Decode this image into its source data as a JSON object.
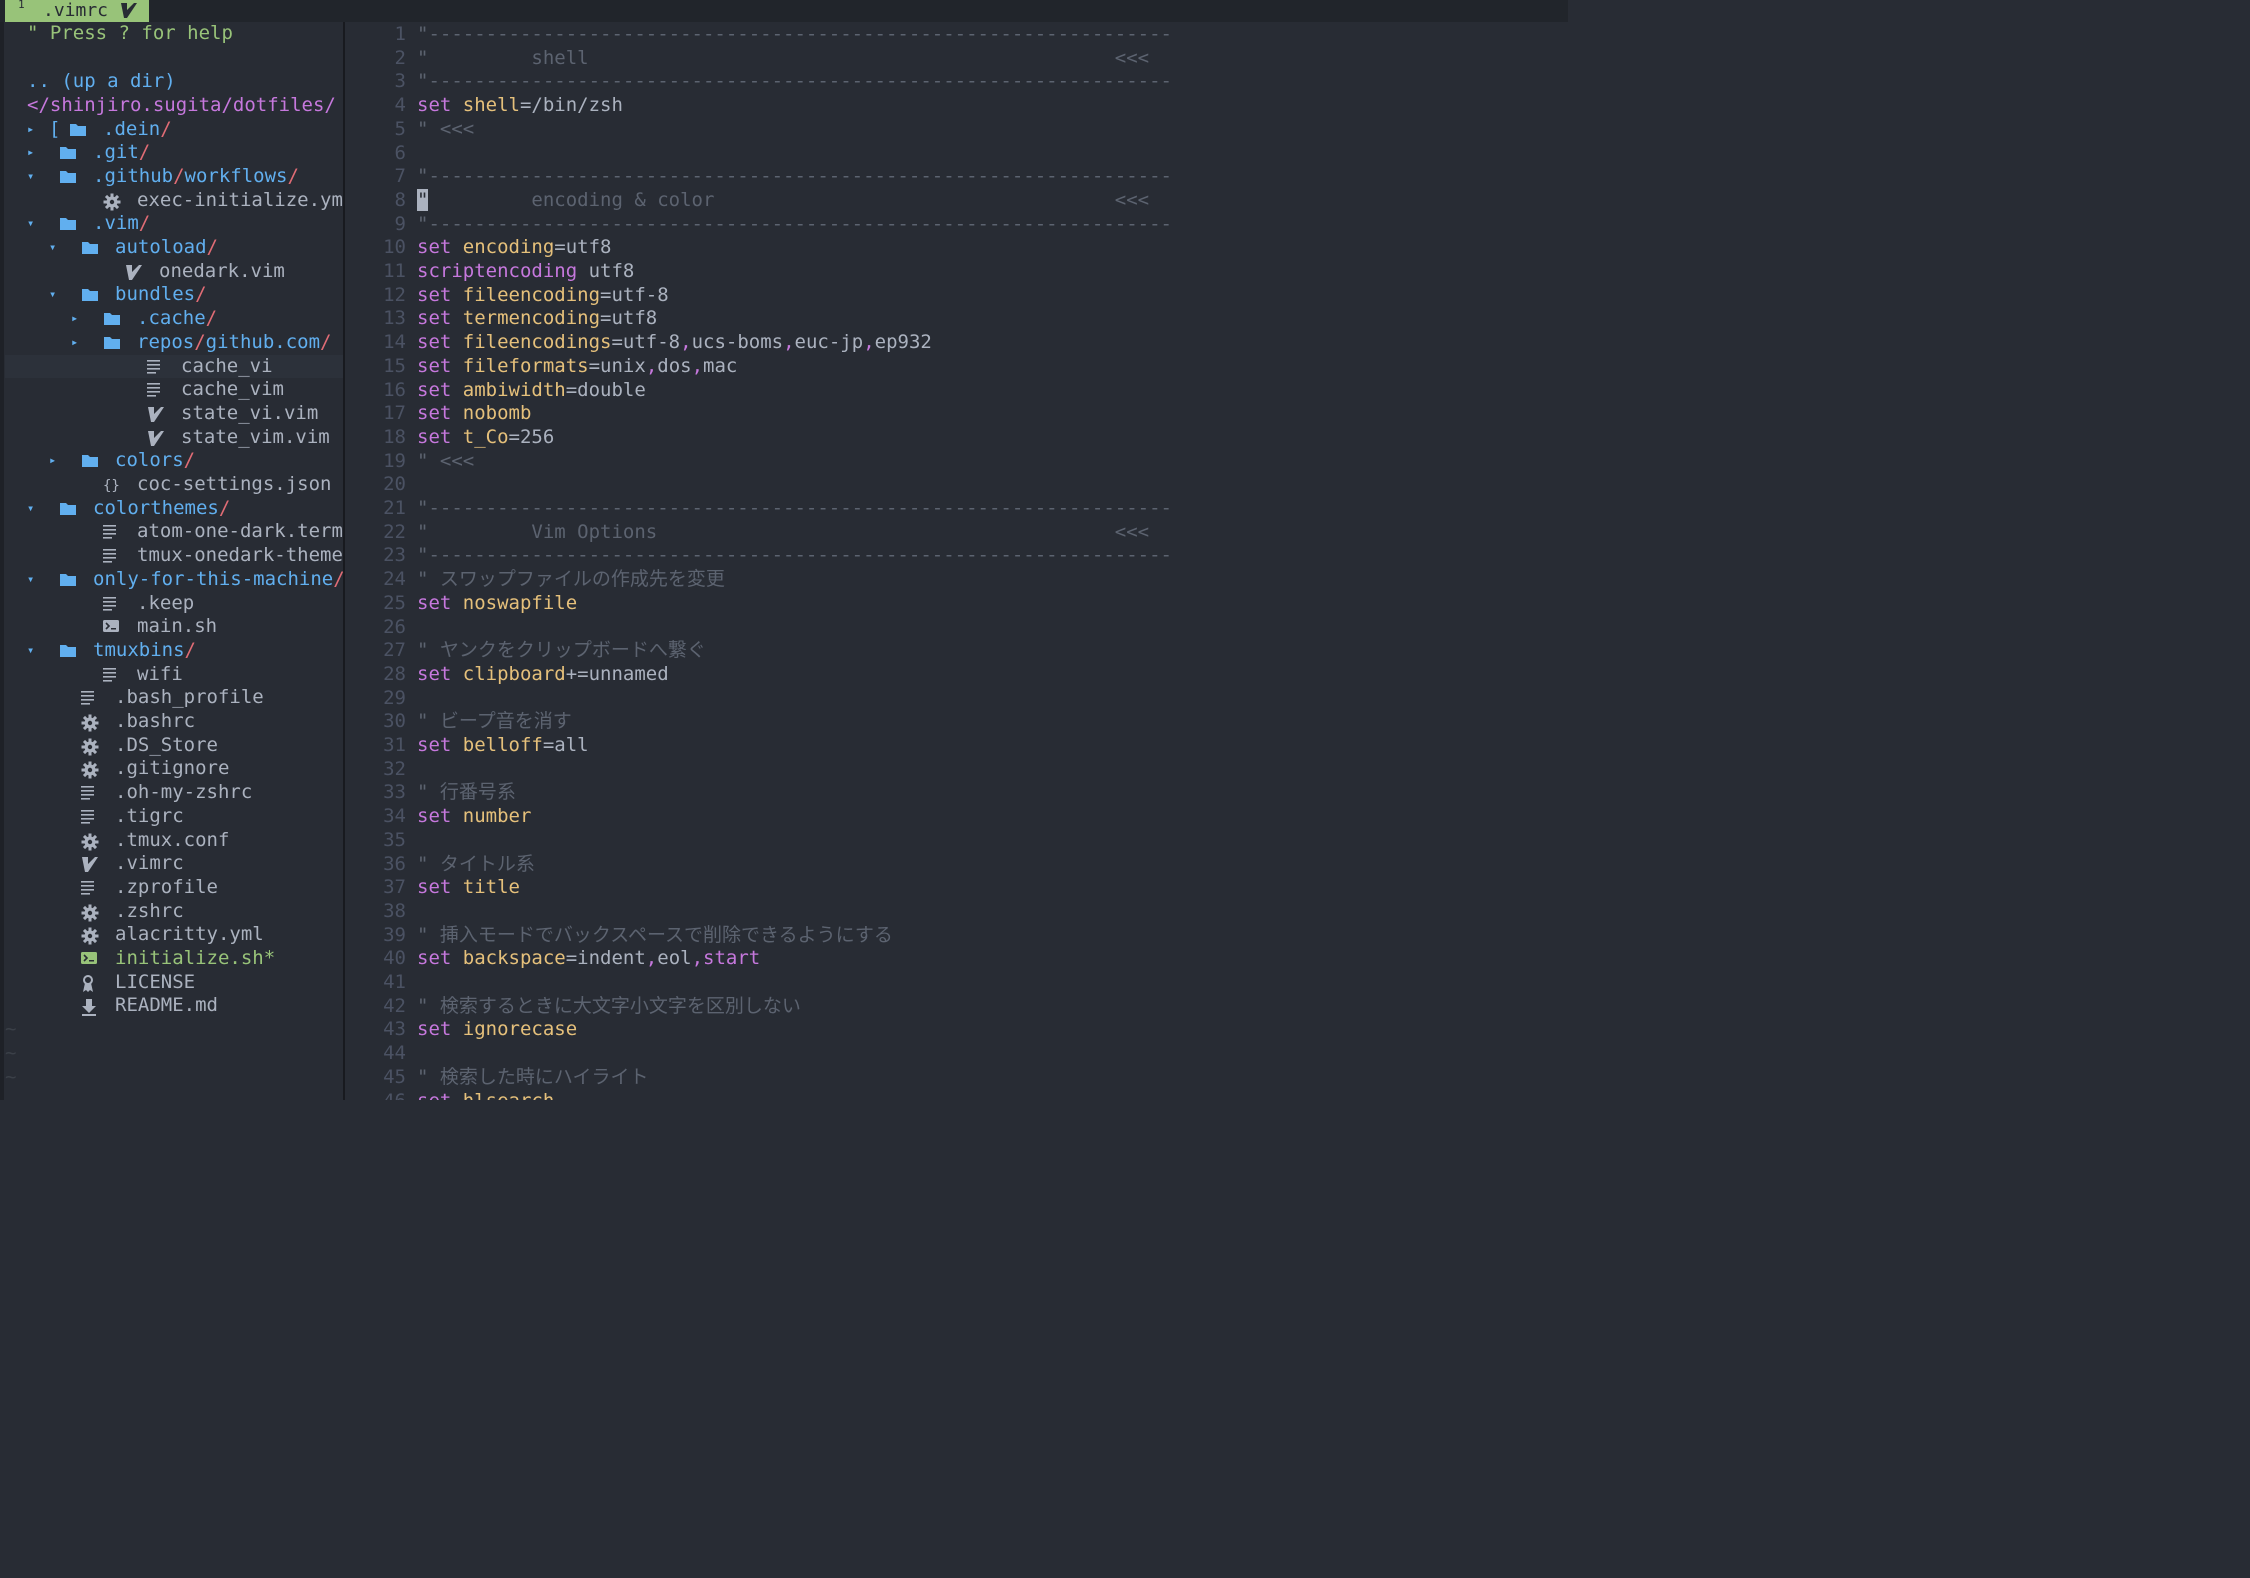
{
  "tab": {
    "number": "1",
    "name": ".vimrc"
  },
  "tree": {
    "help": "\" Press ? for help",
    "updir": ".. (up a dir)",
    "cwd": "</shinjiro.sugita/dotfiles/",
    "rows": [
      {
        "arrow": "▸",
        "bracket": "[",
        "icon": "folder-icon",
        "parts": [
          ".dein"
        ],
        "type": "dir"
      },
      {
        "arrow": "▸",
        "icon": "folder-icon",
        "parts": [
          ".git"
        ],
        "type": "dir"
      },
      {
        "arrow": "▾",
        "icon": "folder-icon",
        "parts": [
          ".github",
          "workflows"
        ],
        "type": "dir"
      },
      {
        "icon": "gear-icon",
        "name": "exec-initialize.yml",
        "type": "file"
      },
      {
        "arrow": "▾",
        "icon": "folder-icon",
        "parts": [
          ".vim"
        ],
        "type": "dir"
      },
      {
        "arrow": "▾",
        "icon": "folder-icon",
        "parts": [
          "autoload"
        ],
        "type": "dir"
      },
      {
        "icon": "vim-icon",
        "name": "onedark.vim",
        "type": "file"
      },
      {
        "arrow": "▾",
        "icon": "folder-icon",
        "parts": [
          "bundles"
        ],
        "type": "dir"
      },
      {
        "arrow": "▸",
        "icon": "folder-icon",
        "parts": [
          ".cache"
        ],
        "type": "dir"
      },
      {
        "arrow": "▸",
        "icon": "folder-icon",
        "parts": [
          "repos",
          "github.com"
        ],
        "type": "dir"
      },
      {
        "icon": "text-file-icon",
        "name": "cache_vi",
        "type": "file",
        "selected": true
      },
      {
        "icon": "text-file-icon",
        "name": "cache_vim",
        "type": "file"
      },
      {
        "icon": "vim-icon",
        "name": "state_vi.vim",
        "type": "file"
      },
      {
        "icon": "vim-icon",
        "name": "state_vim.vim",
        "type": "file"
      },
      {
        "arrow": "▸",
        "icon": "folder-icon",
        "parts": [
          "colors"
        ],
        "type": "dir"
      },
      {
        "icon": "json-icon",
        "name": "coc-settings.json",
        "type": "file"
      },
      {
        "arrow": "▾",
        "icon": "folder-icon",
        "parts": [
          "colorthemes"
        ],
        "type": "dir"
      },
      {
        "icon": "text-file-icon",
        "name": "atom-one-dark.termin",
        "type": "file"
      },
      {
        "icon": "text-file-icon",
        "name": "tmux-onedark-theme.t",
        "type": "file"
      },
      {
        "arrow": "▾",
        "icon": "folder-icon",
        "parts": [
          "only-for-this-machine"
        ],
        "type": "dir"
      },
      {
        "icon": "text-file-icon",
        "name": ".keep",
        "type": "file"
      },
      {
        "icon": "terminal-icon",
        "name": "main.sh",
        "type": "file"
      },
      {
        "arrow": "▾",
        "icon": "folder-icon",
        "parts": [
          "tmuxbins"
        ],
        "type": "dir"
      },
      {
        "icon": "text-file-icon",
        "name": "wifi",
        "type": "file"
      },
      {
        "icon": "text-file-icon",
        "name": ".bash_profile",
        "type": "file"
      },
      {
        "icon": "gear-icon",
        "name": ".bashrc",
        "type": "file"
      },
      {
        "icon": "gear-icon",
        "name": ".DS_Store",
        "type": "file"
      },
      {
        "icon": "gear-icon",
        "name": ".gitignore",
        "type": "file"
      },
      {
        "icon": "text-file-icon",
        "name": ".oh-my-zshrc",
        "type": "file"
      },
      {
        "icon": "text-file-icon",
        "name": ".tigrc",
        "type": "file"
      },
      {
        "icon": "gear-icon",
        "name": ".tmux.conf",
        "type": "file"
      },
      {
        "icon": "vim-icon",
        "name": ".vimrc",
        "type": "file"
      },
      {
        "icon": "text-file-icon",
        "name": ".zprofile",
        "type": "file"
      },
      {
        "icon": "gear-icon",
        "name": ".zshrc",
        "type": "file"
      },
      {
        "icon": "gear-icon",
        "name": "alacritty.yml",
        "type": "file"
      },
      {
        "icon": "terminal-icon",
        "name": "initialize.sh*",
        "type": "file",
        "exec": true
      },
      {
        "icon": "license-icon",
        "name": "LICENSE",
        "type": "file"
      },
      {
        "icon": "download-icon",
        "name": "README.md",
        "type": "file"
      }
    ],
    "tildes": [
      "~",
      "~",
      "~"
    ]
  },
  "editor": {
    "lines": [
      {
        "n": "1",
        "t": [
          [
            "cmt",
            "\"-----------------------------------------------------------------"
          ]
        ]
      },
      {
        "n": "2",
        "t": [
          [
            "cmt",
            "\"         shell                                              <<<"
          ]
        ]
      },
      {
        "n": "3",
        "t": [
          [
            "cmt",
            "\"-----------------------------------------------------------------"
          ]
        ]
      },
      {
        "n": "4",
        "t": [
          [
            "kw",
            "set "
          ],
          [
            "opt",
            "shell"
          ],
          [
            "val",
            "=/bin/zsh"
          ]
        ]
      },
      {
        "n": "5",
        "t": [
          [
            "cmt",
            "\" <<<"
          ]
        ]
      },
      {
        "n": "6",
        "t": []
      },
      {
        "n": "7",
        "t": [
          [
            "cmt",
            "\"-----------------------------------------------------------------"
          ]
        ]
      },
      {
        "n": "8",
        "t": [
          [
            "cursor",
            "\""
          ],
          [
            "cmt",
            "         encoding & color                                   <<<"
          ]
        ]
      },
      {
        "n": "9",
        "t": [
          [
            "cmt",
            "\"-----------------------------------------------------------------"
          ]
        ]
      },
      {
        "n": "10",
        "t": [
          [
            "kw",
            "set "
          ],
          [
            "opt",
            "encoding"
          ],
          [
            "val",
            "=utf8"
          ]
        ]
      },
      {
        "n": "11",
        "t": [
          [
            "kw",
            "scriptencoding "
          ],
          [
            "val",
            "utf8"
          ]
        ]
      },
      {
        "n": "12",
        "t": [
          [
            "kw",
            "set "
          ],
          [
            "opt",
            "fileencoding"
          ],
          [
            "val",
            "=utf-8"
          ]
        ]
      },
      {
        "n": "13",
        "t": [
          [
            "kw",
            "set "
          ],
          [
            "opt",
            "termencoding"
          ],
          [
            "val",
            "=utf8"
          ]
        ]
      },
      {
        "n": "14",
        "t": [
          [
            "kw",
            "set "
          ],
          [
            "opt",
            "fileencodings"
          ],
          [
            "val",
            "=utf-8"
          ],
          [
            "kw",
            ","
          ],
          [
            "val",
            "ucs-boms"
          ],
          [
            "kw",
            ","
          ],
          [
            "val",
            "euc-jp"
          ],
          [
            "kw",
            ","
          ],
          [
            "val",
            "ep932"
          ]
        ]
      },
      {
        "n": "15",
        "t": [
          [
            "kw",
            "set "
          ],
          [
            "opt",
            "fileformats"
          ],
          [
            "val",
            "=unix"
          ],
          [
            "kw",
            ","
          ],
          [
            "val",
            "dos"
          ],
          [
            "kw",
            ","
          ],
          [
            "val",
            "mac"
          ]
        ]
      },
      {
        "n": "16",
        "t": [
          [
            "kw",
            "set "
          ],
          [
            "opt",
            "ambiwidth"
          ],
          [
            "val",
            "=double"
          ]
        ]
      },
      {
        "n": "17",
        "t": [
          [
            "kw",
            "set "
          ],
          [
            "opt",
            "nobomb"
          ]
        ]
      },
      {
        "n": "18",
        "t": [
          [
            "kw",
            "set "
          ],
          [
            "opt",
            "t_Co"
          ],
          [
            "val",
            "=256"
          ]
        ]
      },
      {
        "n": "19",
        "t": [
          [
            "cmt",
            "\" <<<"
          ]
        ]
      },
      {
        "n": "20",
        "t": []
      },
      {
        "n": "21",
        "t": [
          [
            "cmt",
            "\"-----------------------------------------------------------------"
          ]
        ]
      },
      {
        "n": "22",
        "t": [
          [
            "cmt",
            "\"         Vim Options                                        <<<"
          ]
        ]
      },
      {
        "n": "23",
        "t": [
          [
            "cmt",
            "\"-----------------------------------------------------------------"
          ]
        ]
      },
      {
        "n": "24",
        "t": [
          [
            "cmt",
            "\" スワップファイルの作成先を変更"
          ]
        ]
      },
      {
        "n": "25",
        "t": [
          [
            "kw",
            "set "
          ],
          [
            "opt",
            "noswapfile"
          ]
        ]
      },
      {
        "n": "26",
        "t": []
      },
      {
        "n": "27",
        "t": [
          [
            "cmt",
            "\" ヤンクをクリップボードへ繋ぐ"
          ]
        ]
      },
      {
        "n": "28",
        "t": [
          [
            "kw",
            "set "
          ],
          [
            "opt",
            "clipboard"
          ],
          [
            "val",
            "+=unnamed"
          ]
        ]
      },
      {
        "n": "29",
        "t": []
      },
      {
        "n": "30",
        "t": [
          [
            "cmt",
            "\" ビープ音を消す"
          ]
        ]
      },
      {
        "n": "31",
        "t": [
          [
            "kw",
            "set "
          ],
          [
            "opt",
            "belloff"
          ],
          [
            "val",
            "=all"
          ]
        ]
      },
      {
        "n": "32",
        "t": []
      },
      {
        "n": "33",
        "t": [
          [
            "cmt",
            "\" 行番号系"
          ]
        ]
      },
      {
        "n": "34",
        "t": [
          [
            "kw",
            "set "
          ],
          [
            "opt",
            "number"
          ]
        ]
      },
      {
        "n": "35",
        "t": []
      },
      {
        "n": "36",
        "t": [
          [
            "cmt",
            "\" タイトル系"
          ]
        ]
      },
      {
        "n": "37",
        "t": [
          [
            "kw",
            "set "
          ],
          [
            "opt",
            "title"
          ]
        ]
      },
      {
        "n": "38",
        "t": []
      },
      {
        "n": "39",
        "t": [
          [
            "cmt",
            "\" 挿入モードでバックスペースで削除できるようにする"
          ]
        ]
      },
      {
        "n": "40",
        "t": [
          [
            "kw",
            "set "
          ],
          [
            "opt",
            "backspace"
          ],
          [
            "val",
            "=indent"
          ],
          [
            "kw",
            ","
          ],
          [
            "val",
            "eol"
          ],
          [
            "kw",
            ","
          ],
          [
            "kw",
            "start"
          ]
        ]
      },
      {
        "n": "41",
        "t": []
      },
      {
        "n": "42",
        "t": [
          [
            "cmt",
            "\" 検索するときに大文字小文字を区別しない"
          ]
        ]
      },
      {
        "n": "43",
        "t": [
          [
            "kw",
            "set "
          ],
          [
            "opt",
            "ignorecase"
          ]
        ]
      },
      {
        "n": "44",
        "t": []
      },
      {
        "n": "45",
        "t": [
          [
            "cmt",
            "\" 検索した時にハイライト"
          ]
        ]
      },
      {
        "n": "46",
        "t": [
          [
            "kw",
            "set "
          ],
          [
            "opt",
            "hlsearch"
          ]
        ]
      }
    ]
  },
  "colors": {
    "background": "#282c34",
    "tab_active": "#98c379",
    "folder": "#61afef",
    "slash": "#e06c75",
    "keyword": "#c678dd",
    "option": "#e5c07b",
    "comment": "#5c6370",
    "line_number": "#4b5263"
  }
}
